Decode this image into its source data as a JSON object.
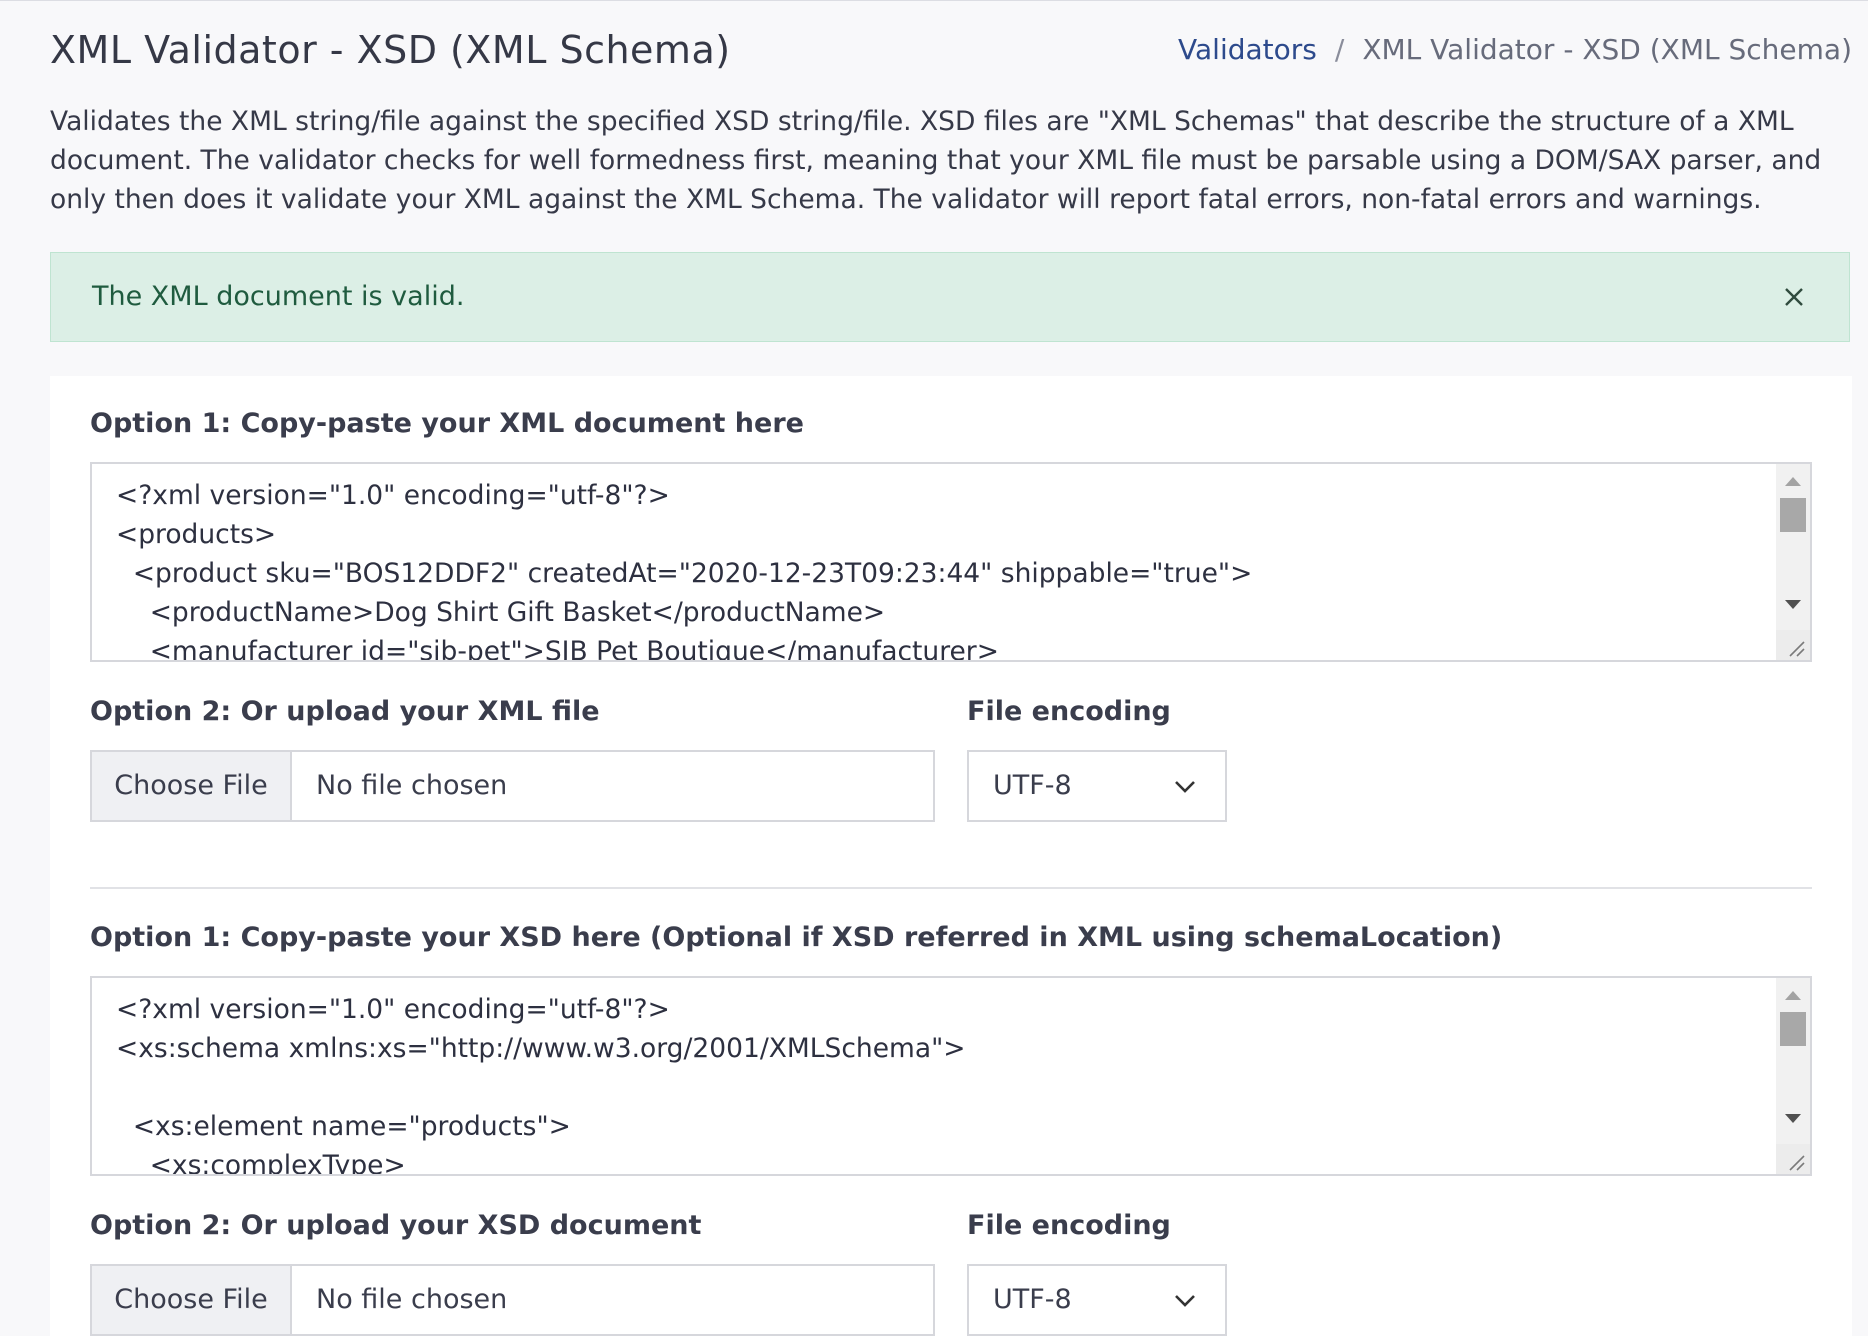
{
  "header": {
    "title": "XML Validator - XSD (XML Schema)",
    "breadcrumb": {
      "link": "Validators",
      "separator": "/",
      "current": "XML Validator - XSD (XML Schema)"
    }
  },
  "description": "Validates the XML string/file against the specified XSD string/file. XSD files are \"XML Schemas\" that describe the structure of a XML document. The validator checks for well formedness first, meaning that your XML file must be parsable using a DOM/SAX parser, and only then does it validate your XML against the XML Schema. The validator will report fatal errors, non-fatal errors and warnings.",
  "alert": {
    "message": "The XML document is valid.",
    "close_icon": "close-icon"
  },
  "xml_section": {
    "paste_label": "Option 1: Copy-paste your XML document here",
    "code": "<?xml version=\"1.0\" encoding=\"utf-8\"?>\n<products>\n  <product sku=\"BOS12DDF2\" createdAt=\"2020-12-23T09:23:44\" shippable=\"true\">\n    <productName>Dog Shirt Gift Basket</productName>\n    <manufacturer id=\"sjb-pet\">SJB Pet Boutique</manufacturer>",
    "upload_label": "Option 2: Or upload your XML file",
    "choose_button": "Choose File",
    "file_status": "No file chosen",
    "encoding_label": "File encoding",
    "encoding_value": "UTF-8"
  },
  "xsd_section": {
    "paste_label": "Option 1: Copy-paste your XSD here (Optional if XSD referred in XML using schemaLocation)",
    "code": "<?xml version=\"1.0\" encoding=\"utf-8\"?>\n<xs:schema xmlns:xs=\"http://www.w3.org/2001/XMLSchema\">\n\n  <xs:element name=\"products\">\n    <xs:complexType>",
    "upload_label": "Option 2: Or upload your XSD document",
    "choose_button": "Choose File",
    "file_status": "No file chosen",
    "encoding_label": "File encoding",
    "encoding_value": "UTF-8"
  },
  "colors": {
    "success_bg": "#dcefe6",
    "success_text": "#1f5b3f",
    "link": "#2d4a8c"
  }
}
